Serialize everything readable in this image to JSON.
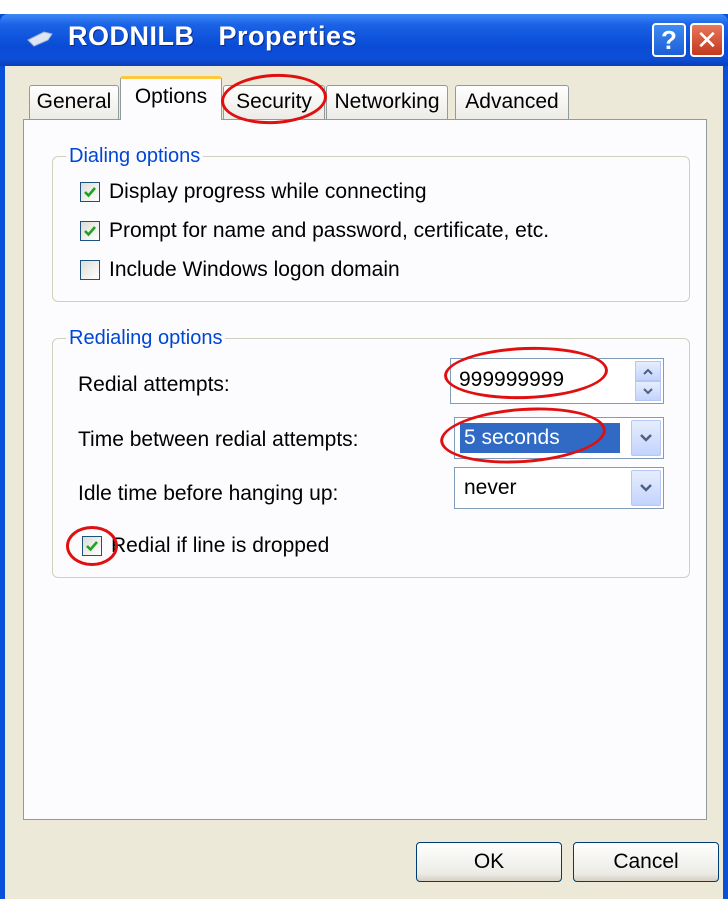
{
  "window": {
    "title_name": "RODNILB",
    "title_suffix": "Properties",
    "help_label": "?",
    "close_label": "✕"
  },
  "tabs": [
    {
      "label": "General",
      "active": false
    },
    {
      "label": "Options",
      "active": true
    },
    {
      "label": "Security",
      "active": false
    },
    {
      "label": "Networking",
      "active": false
    },
    {
      "label": "Advanced",
      "active": false
    }
  ],
  "dialing": {
    "title": "Dialing options",
    "items": [
      {
        "label": "Display progress while connecting",
        "checked": true
      },
      {
        "label": "Prompt for name and password, certificate, etc.",
        "checked": true
      },
      {
        "label": "Include Windows logon domain",
        "checked": false
      }
    ]
  },
  "redialing": {
    "title": "Redialing options",
    "attempts_label": "Redial attempts:",
    "attempts_value": "999999999",
    "time_label": "Time between redial attempts:",
    "time_value": "5 seconds",
    "idle_label": "Idle time before hanging up:",
    "idle_value": "never",
    "redial_dropped_label": "Redial if line is dropped",
    "redial_dropped_checked": true
  },
  "buttons": {
    "ok": "OK",
    "cancel": "Cancel"
  },
  "colors": {
    "accent": "#0046d5",
    "annotation": "#e01010",
    "selection": "#316ac5"
  }
}
